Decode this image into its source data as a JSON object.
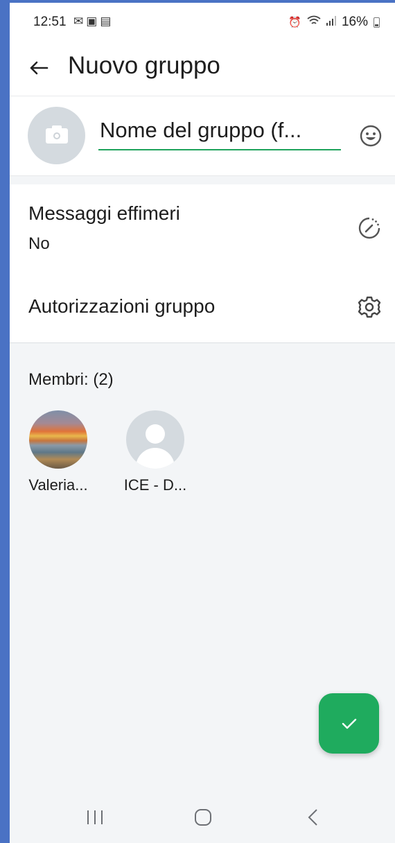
{
  "status_bar": {
    "time": "12:51",
    "left_icons": [
      "gmail-icon",
      "gallery-icon",
      "calendar-icon"
    ],
    "battery_percent": "16%"
  },
  "app_bar": {
    "title": "Nuovo gruppo",
    "back_icon": "arrow-left-icon"
  },
  "group_name": {
    "value": "Nome del gruppo (f...",
    "accent_color": "#1ea35b"
  },
  "settings": {
    "ephemeral": {
      "title": "Messaggi effimeri",
      "value": "No",
      "icon": "timer-icon"
    },
    "permissions": {
      "title": "Autorizzazioni gruppo",
      "icon": "gear-icon"
    }
  },
  "members": {
    "label": "Membri: (2)",
    "items": [
      {
        "name": "Valeria...",
        "avatar": "painting-photo"
      },
      {
        "name": "ICE - D...",
        "avatar": "default-person-icon"
      }
    ]
  },
  "fab": {
    "icon": "check-icon",
    "color": "#1fab5e"
  },
  "nav_bar": [
    "recents-icon",
    "home-icon",
    "back-icon"
  ]
}
